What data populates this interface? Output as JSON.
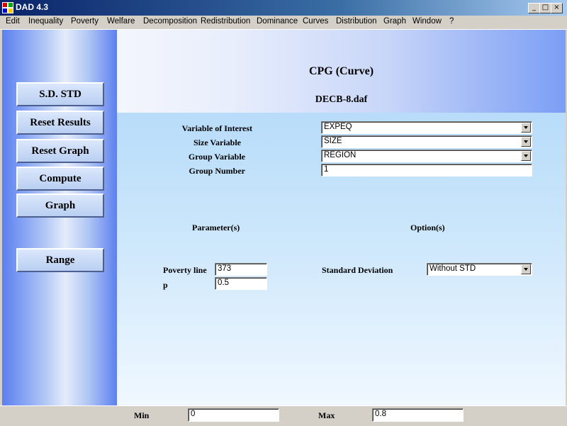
{
  "window": {
    "title": "DAD 4.3",
    "minimize": "_",
    "maximize": "□",
    "close": "×"
  },
  "menu": [
    "Edit",
    "Inequality",
    "Poverty",
    "Welfare",
    "Decomposition",
    "Redistribution",
    "Dominance",
    "Curves",
    "Distribution",
    "Graph",
    "Window",
    "?"
  ],
  "sidebar": {
    "buttons": [
      "S.D. STD",
      "Reset Results",
      "Reset Graph",
      "Compute",
      "Graph",
      "Range"
    ]
  },
  "header": {
    "title": "CPG (Curve)",
    "file": "DECB-8.daf"
  },
  "variables": {
    "interest_label": "Variable of Interest",
    "interest_value": "EXPEQ",
    "size_label": "Size Variable",
    "size_value": "SIZE",
    "group_label": "Group Variable",
    "group_value": "REGION",
    "group_number_label": "Group Number",
    "group_number_value": "1"
  },
  "sections": {
    "parameters": "Parameter(s)",
    "options": "Option(s)"
  },
  "parameters": {
    "poverty_line_label": "Poverty line",
    "poverty_line_value": "373",
    "p_label": "p",
    "p_value": "0.5"
  },
  "options": {
    "std_label": "Standard Deviation",
    "std_value": "Without STD"
  },
  "status": {
    "min_label": "Min",
    "min_value": "0",
    "max_label": "Max",
    "max_value": "0.8"
  },
  "colors": {
    "titlebar": "#0a246a",
    "panel_blue": "#5a7ff0",
    "main_area": "#cbe6fb"
  }
}
